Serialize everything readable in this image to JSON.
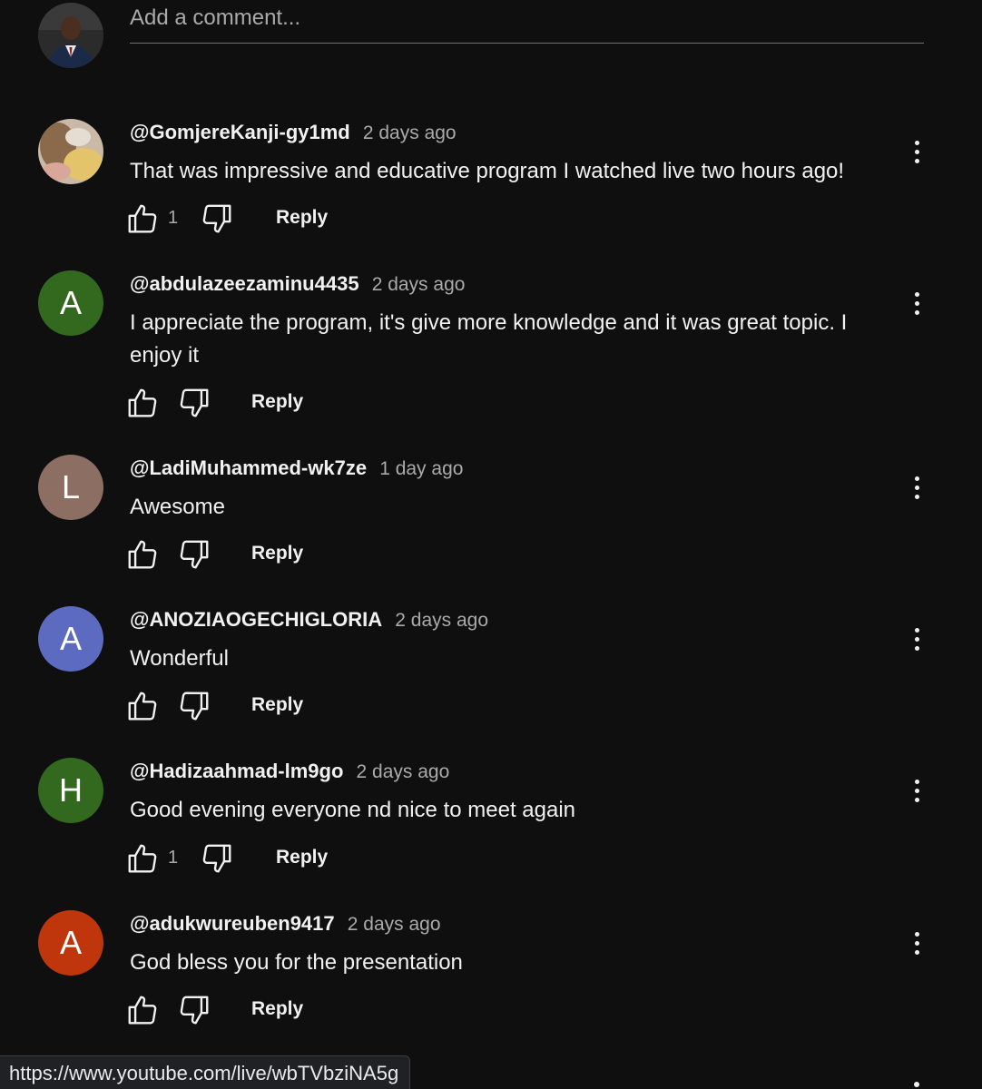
{
  "add_comment": {
    "placeholder": "Add a comment..."
  },
  "comments": [
    {
      "author": "@GomjereKanji-gy1md",
      "time": "2 days ago",
      "text": "That was impressive and educative program I watched live two hours ago!",
      "likes": "1",
      "reply_label": "Reply",
      "avatar_letter": "",
      "avatar_color": "#b08a5a"
    },
    {
      "author": "@abdulazeezaminu4435",
      "time": "2 days ago",
      "text": "I appreciate the program, it's give more knowledge and it was great topic. I enjoy it",
      "likes": "",
      "reply_label": "Reply",
      "avatar_letter": "A",
      "avatar_color": "#33691e"
    },
    {
      "author": "@LadiMuhammed-wk7ze",
      "time": "1 day ago",
      "text": "Awesome",
      "likes": "",
      "reply_label": "Reply",
      "avatar_letter": "L",
      "avatar_color": "#8d6e63"
    },
    {
      "author": "@ANOZIAOGECHIGLORIA",
      "time": "2 days ago",
      "text": "Wonderful",
      "likes": "",
      "reply_label": "Reply",
      "avatar_letter": "A",
      "avatar_color": "#5c6bc0"
    },
    {
      "author": "@Hadizaahmad-lm9go",
      "time": "2 days ago",
      "text": "Good evening everyone nd nice to meet again",
      "likes": "1",
      "reply_label": "Reply",
      "avatar_letter": "H",
      "avatar_color": "#33691e"
    },
    {
      "author": "@adukwureuben9417",
      "time": "2 days ago",
      "text": "God bless you for the presentation",
      "likes": "",
      "reply_label": "Reply",
      "avatar_letter": "A",
      "avatar_color": "#bf360c"
    }
  ],
  "status_bar": {
    "url": "https://www.youtube.com/live/wbTVbziNA5g"
  },
  "icons": {
    "like": "thumb-up-outline-icon",
    "dislike": "thumb-down-outline-icon",
    "menu": "more-vertical-icon"
  }
}
